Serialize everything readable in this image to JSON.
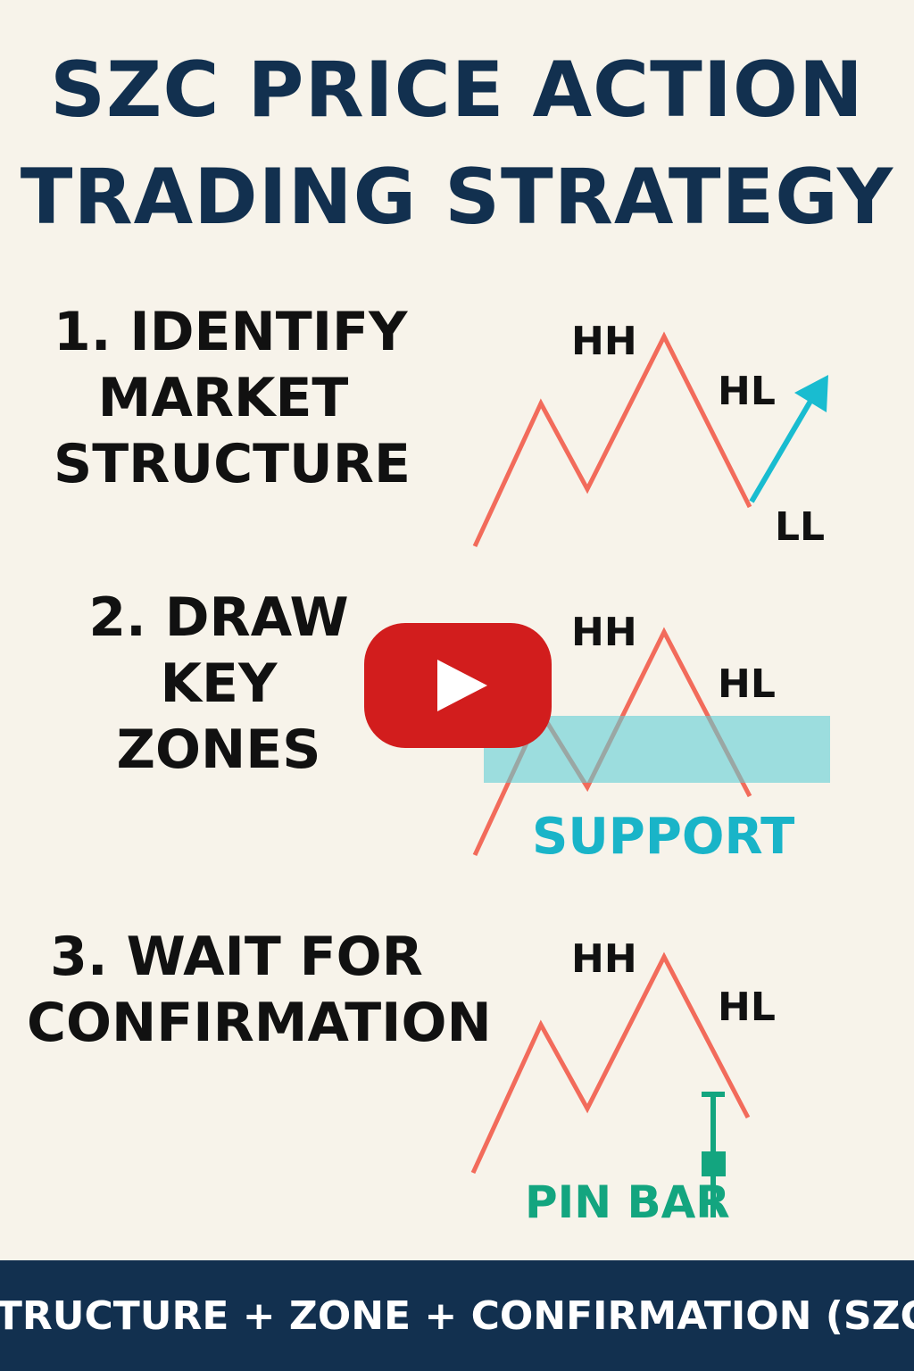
{
  "title": {
    "line1": "SZC PRICE ACTION",
    "line2": "TRADING STRATEGY"
  },
  "steps": [
    {
      "lines": [
        "1. IDENTIFY",
        "MARKET",
        "STRUCTURE"
      ]
    },
    {
      "lines": [
        "2. DRAW",
        "KEY",
        "ZONES"
      ]
    },
    {
      "lines": [
        "3. WAIT FOR",
        "CONFIRMATION"
      ]
    }
  ],
  "diagram1": {
    "hh": "HH",
    "hl": "HL",
    "ll": "LL"
  },
  "diagram2": {
    "hh": "HH",
    "hl": "HL",
    "zone_label": "SUPPORT"
  },
  "diagram3": {
    "hh": "HH",
    "hl": "HL",
    "candle_label": "PIN BAR"
  },
  "video_overlay": {
    "icon": "play-button-icon"
  },
  "footer": {
    "text": "STRUCTURE + ZONE + CONFIRMATION (SZC)"
  },
  "colors": {
    "background": "#f7f3ea",
    "title": "#12304f",
    "price_line": "#f26b5b",
    "arrow": "#19bcd0",
    "zone_fill": "#5fcfd6",
    "support_text": "#19b4c8",
    "pin_bar": "#13a57f",
    "footer_bg": "#12304f",
    "play_button": "#d21d1d"
  }
}
